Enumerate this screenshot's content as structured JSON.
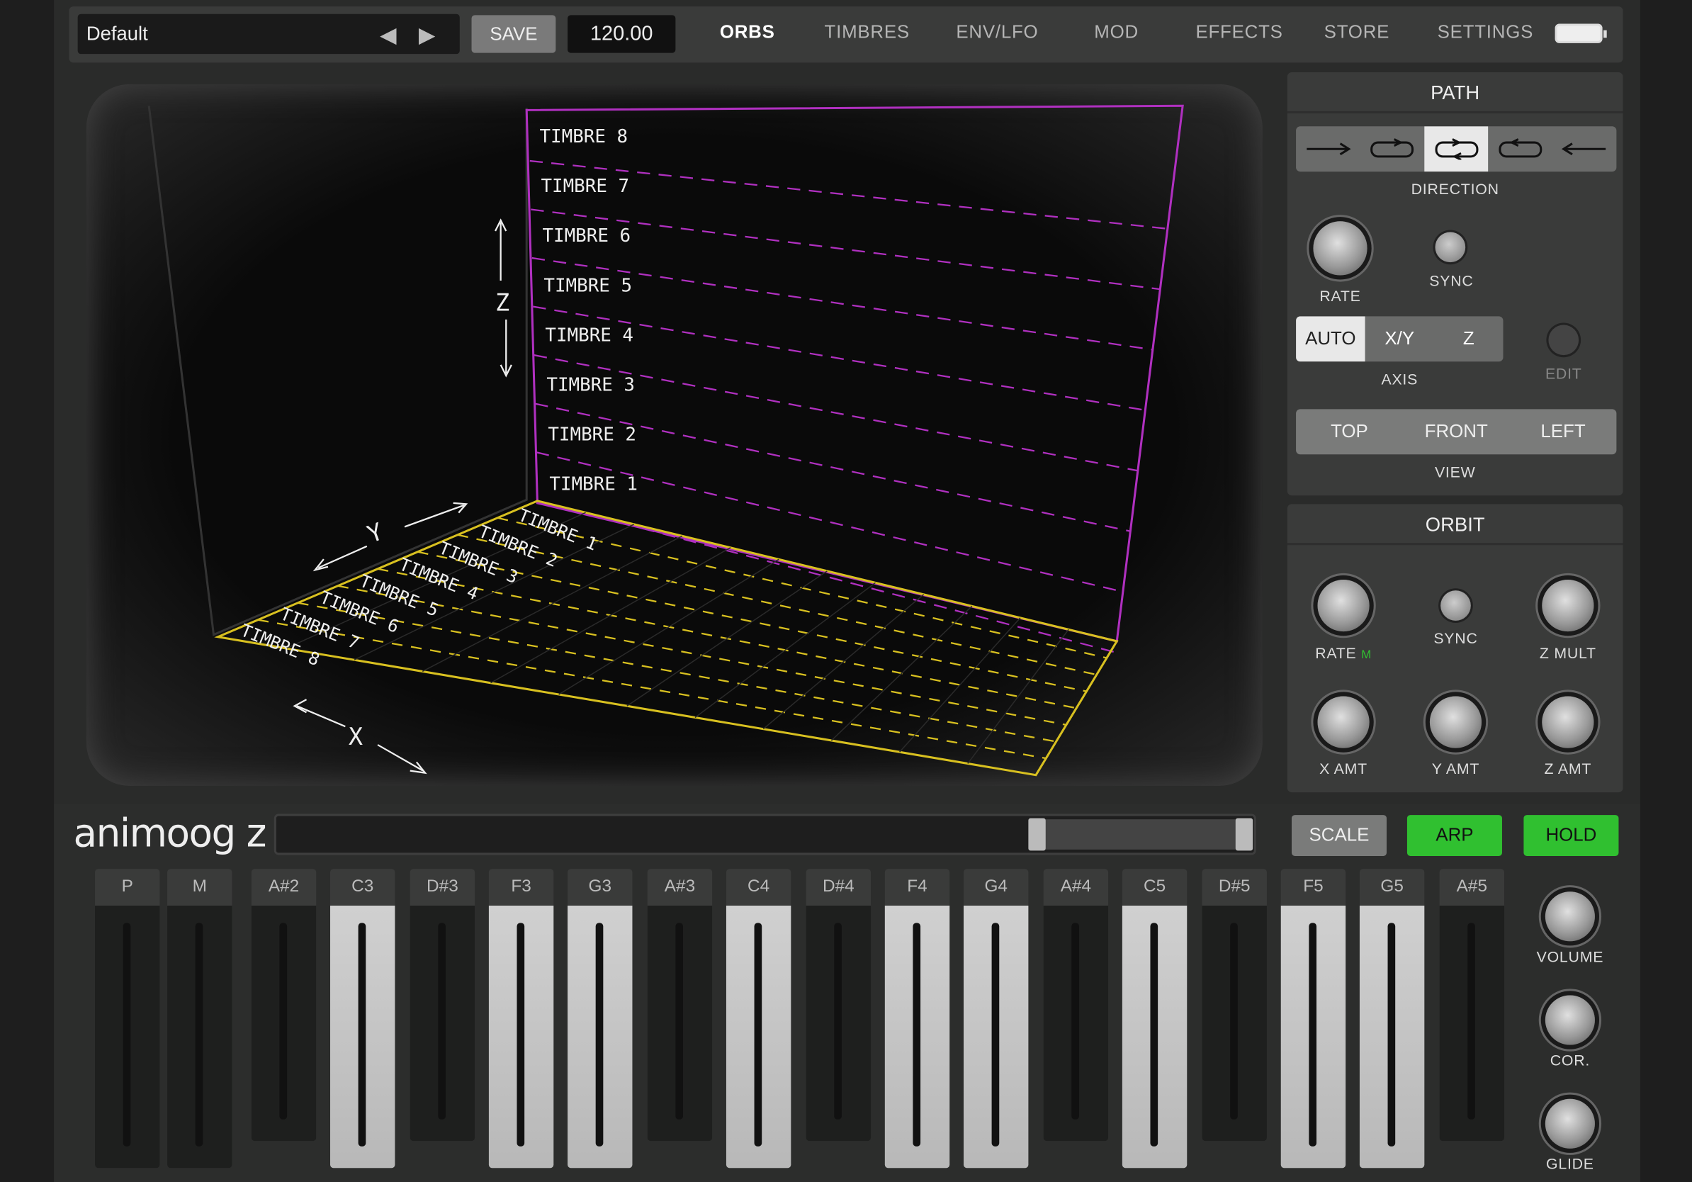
{
  "app": {
    "logo": "animoog z"
  },
  "toolbar": {
    "preset_name": "Default",
    "prev_icon": "triangle-left",
    "next_icon": "triangle-right",
    "save_label": "SAVE",
    "tempo": "120.00",
    "tabs": [
      {
        "label": "ORBS",
        "active": true
      },
      {
        "label": "TIMBRES",
        "active": false
      },
      {
        "label": "ENV/LFO",
        "active": false
      },
      {
        "label": "MOD",
        "active": false
      },
      {
        "label": "EFFECTS",
        "active": false
      },
      {
        "label": "STORE",
        "active": false
      },
      {
        "label": "SETTINGS",
        "active": false
      }
    ]
  },
  "display": {
    "axis_z": "Z",
    "axis_y": "Y",
    "axis_x": "X",
    "wall_labels": [
      "TIMBRE 8",
      "TIMBRE 7",
      "TIMBRE 6",
      "TIMBRE 5",
      "TIMBRE 4",
      "TIMBRE 3",
      "TIMBRE 2",
      "TIMBRE 1"
    ],
    "floor_labels": [
      "TIMBRE 1",
      "TIMBRE 2",
      "TIMBRE 3",
      "TIMBRE 4",
      "TIMBRE 5",
      "TIMBRE 6",
      "TIMBRE 7",
      "TIMBRE 8"
    ],
    "colors": {
      "wall": "#b030c0",
      "floor": "#d8c020"
    }
  },
  "path": {
    "title": "PATH",
    "direction_label": "DIRECTION",
    "direction_options": [
      "forward",
      "loop-forward",
      "ping-pong",
      "loop-backward",
      "backward"
    ],
    "direction_selected": 2,
    "rate_label": "RATE",
    "sync_label": "SYNC",
    "axis_label": "AXIS",
    "axis_options": [
      "AUTO",
      "X/Y",
      "Z"
    ],
    "axis_selected": 0,
    "edit_label": "EDIT",
    "view_label": "VIEW",
    "view_options": [
      "TOP",
      "FRONT",
      "LEFT"
    ]
  },
  "orbit": {
    "title": "ORBIT",
    "rate_label": "RATE",
    "rate_mod": "M",
    "sync_label": "SYNC",
    "zmult_label": "Z MULT",
    "xamt_label": "X AMT",
    "yamt_label": "Y AMT",
    "zamt_label": "Z AMT"
  },
  "keyboard": {
    "scale_label": "SCALE",
    "arp_label": "ARP",
    "hold_label": "HOLD",
    "on_color": "#30c030",
    "keys": [
      {
        "name": "P",
        "type": "dark"
      },
      {
        "name": "M",
        "type": "dark"
      },
      {
        "name": "A#2",
        "type": "dark"
      },
      {
        "name": "C3",
        "type": "light"
      },
      {
        "name": "D#3",
        "type": "dark"
      },
      {
        "name": "F3",
        "type": "light"
      },
      {
        "name": "G3",
        "type": "light"
      },
      {
        "name": "A#3",
        "type": "dark"
      },
      {
        "name": "C4",
        "type": "light"
      },
      {
        "name": "D#4",
        "type": "dark"
      },
      {
        "name": "F4",
        "type": "light"
      },
      {
        "name": "G4",
        "type": "light"
      },
      {
        "name": "A#4",
        "type": "dark"
      },
      {
        "name": "C5",
        "type": "light"
      },
      {
        "name": "D#5",
        "type": "dark"
      },
      {
        "name": "F5",
        "type": "light"
      },
      {
        "name": "G5",
        "type": "light"
      },
      {
        "name": "A#5",
        "type": "dark"
      }
    ],
    "volume_label": "VOLUME",
    "cor_label": "COR.",
    "glide_label": "GLIDE"
  }
}
